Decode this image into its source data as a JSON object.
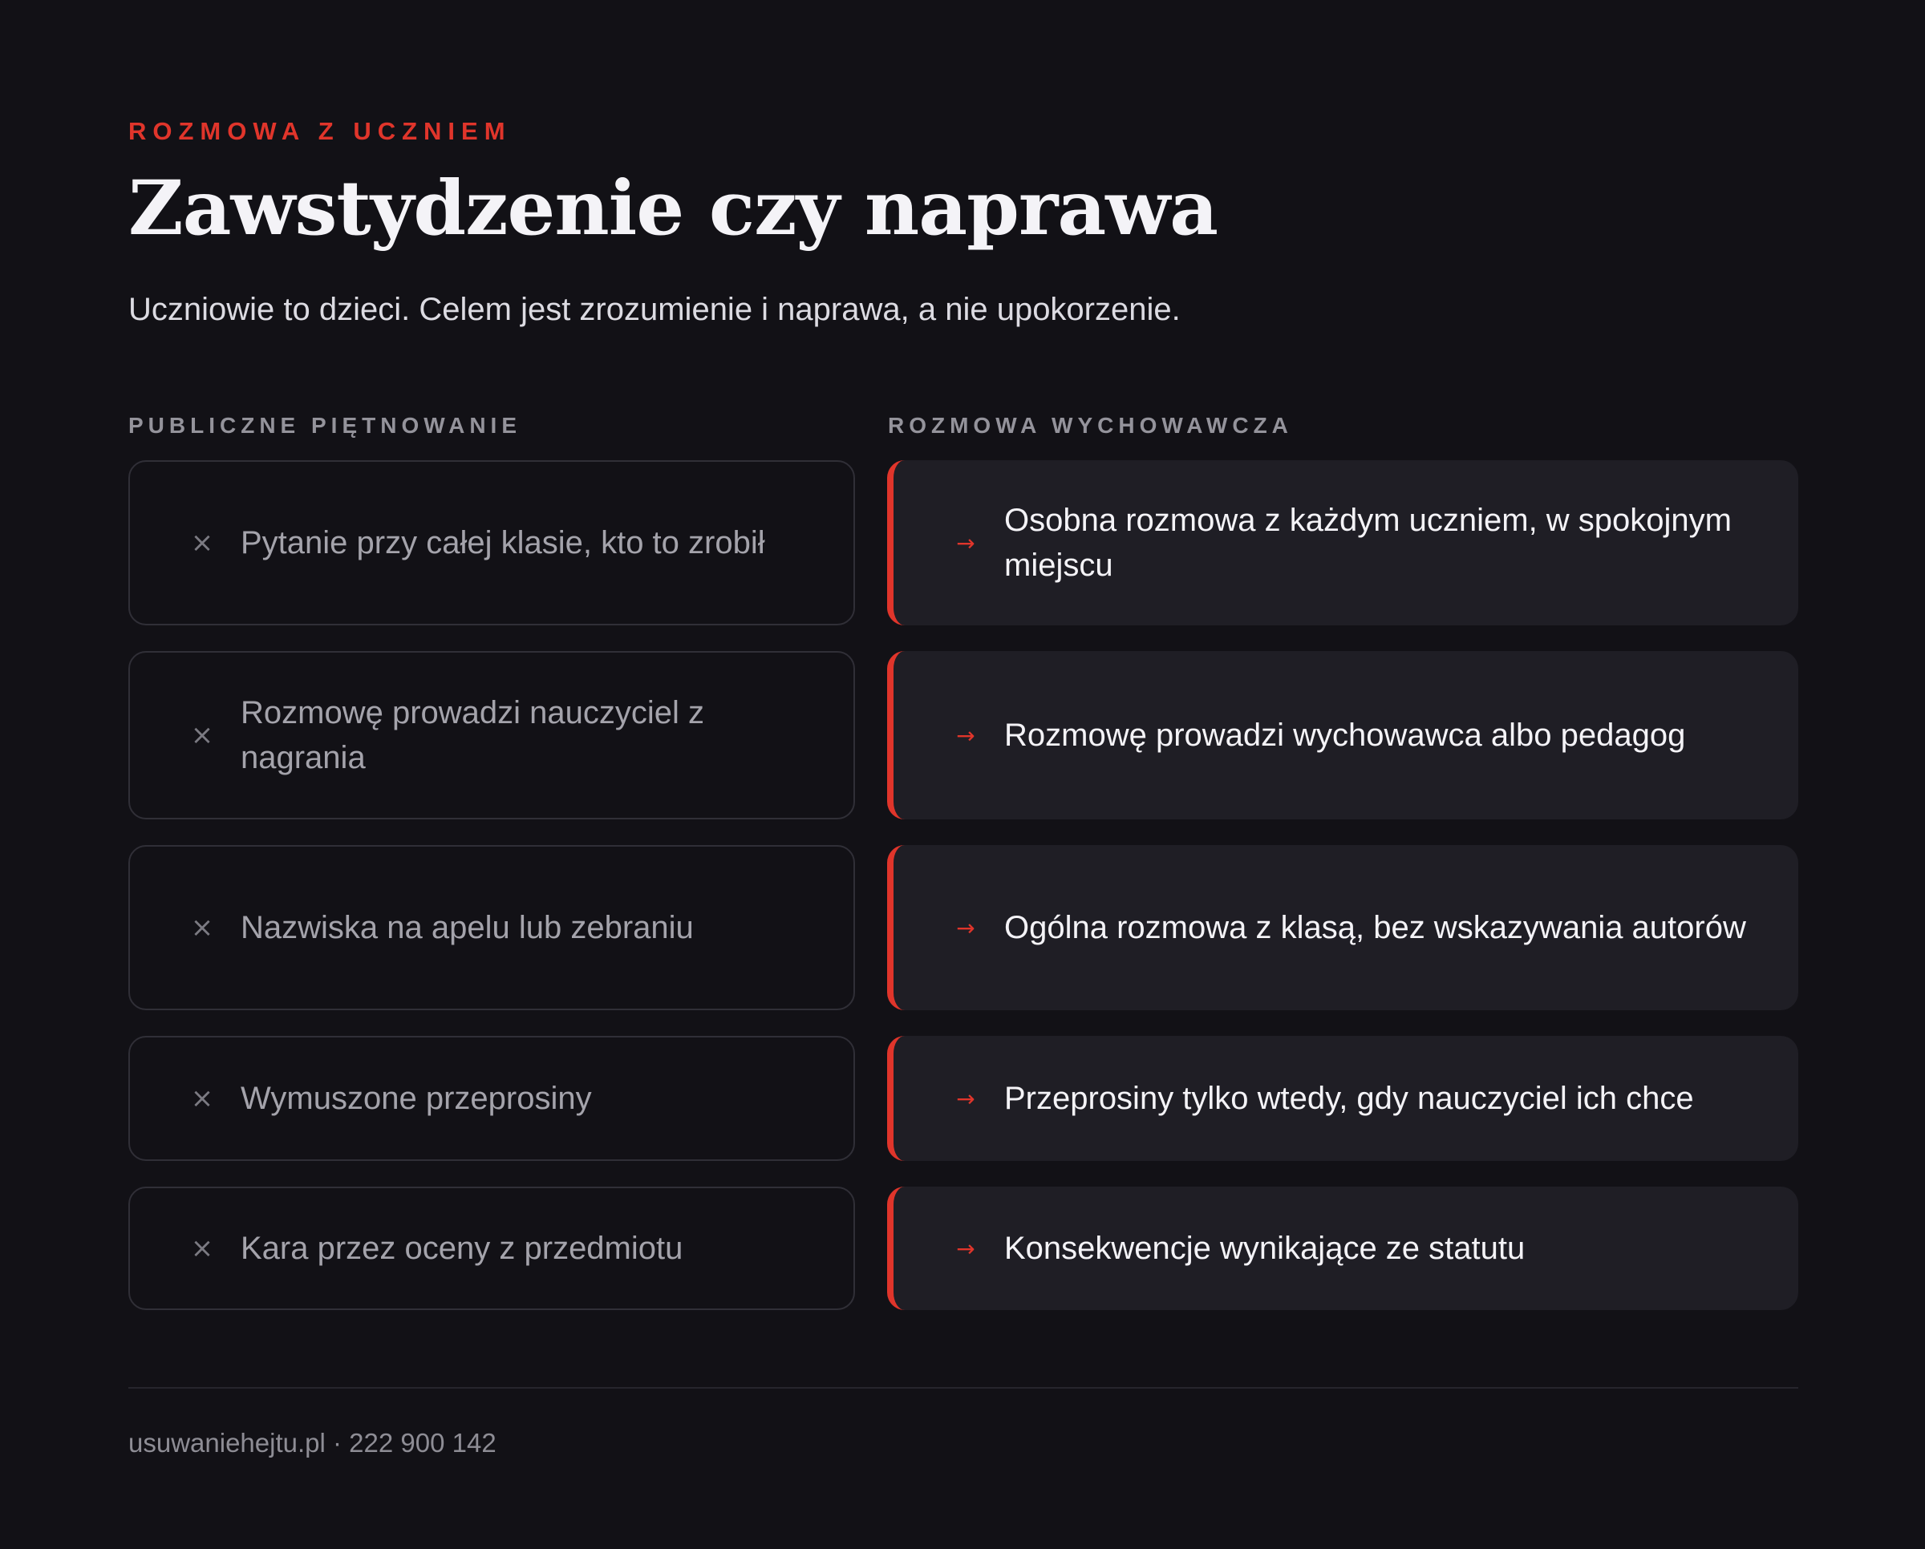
{
  "eyebrow": "ROZMOWA Z UCZNIEM",
  "title": "Zawstydzenie czy naprawa",
  "subtitle": "Uczniowie to dzieci. Celem jest zrozumienie i naprawa, a nie upokorzenie.",
  "columns": {
    "left_heading": "PUBLICZNE PIĘTNOWANIE",
    "right_heading": "ROZMOWA WYCHOWAWCZA"
  },
  "icons": {
    "bad": "×",
    "good": "→",
    "bad_name": "cross-icon",
    "good_name": "arrow-right-icon"
  },
  "rows": [
    {
      "bad": "Pytanie przy całej klasie, kto to zrobił",
      "good": "Osobna rozmowa z każdym uczniem, w spokojnym miejscu"
    },
    {
      "bad": "Rozmowę prowadzi nauczyciel z nagrania",
      "good": "Rozmowę prowadzi wychowawca albo pedagog"
    },
    {
      "bad": "Nazwiska na apelu lub zebraniu",
      "good": "Ogólna rozmowa z klasą, bez wskazywania autorów"
    },
    {
      "bad": "Wymuszone przeprosiny",
      "good": "Przeprosiny tylko wtedy, gdy nauczyciel ich chce"
    },
    {
      "bad": "Kara przez oceny z przedmiotu",
      "good": "Konsekwencje wynikające ze statutu"
    }
  ],
  "footer": "usuwaniehejtu.pl · 222 900 142",
  "colors": {
    "background": "#121116",
    "accent": "#e0352b",
    "good_card": "#1f1e25",
    "bad_border": "#302f37"
  }
}
